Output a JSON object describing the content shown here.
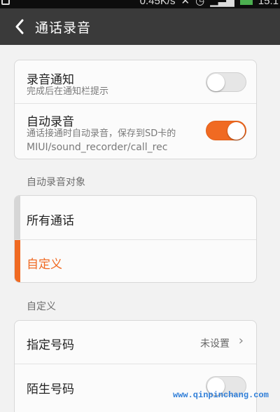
{
  "status_bar": {
    "network_speed": "0.45K/s",
    "time": "15:1"
  },
  "header": {
    "title": "通话录音"
  },
  "settings": [
    {
      "title": "录音通知",
      "subtitle": "完成后在通知栏提示",
      "toggle": "off"
    },
    {
      "title": "自动录音",
      "subtitle_line1": "通话接通时自动录音，保存到SD卡的",
      "subtitle_line2": "MIUI/sound_recorder/call_rec",
      "toggle": "on"
    }
  ],
  "record_target": {
    "section_label": "自动录音对象",
    "options": [
      {
        "label": "所有通话",
        "selected": false
      },
      {
        "label": "自定义",
        "selected": true
      }
    ]
  },
  "custom": {
    "section_label": "自定义",
    "rows": [
      {
        "label": "指定号码",
        "value": "未设置"
      },
      {
        "label": "陌生号码",
        "toggle": "off"
      }
    ]
  },
  "watermark": "www.qinpinchang.com",
  "colors": {
    "accent": "#f06a22",
    "action_bar": "#3a3a3a",
    "background": "#f2f2f2"
  }
}
